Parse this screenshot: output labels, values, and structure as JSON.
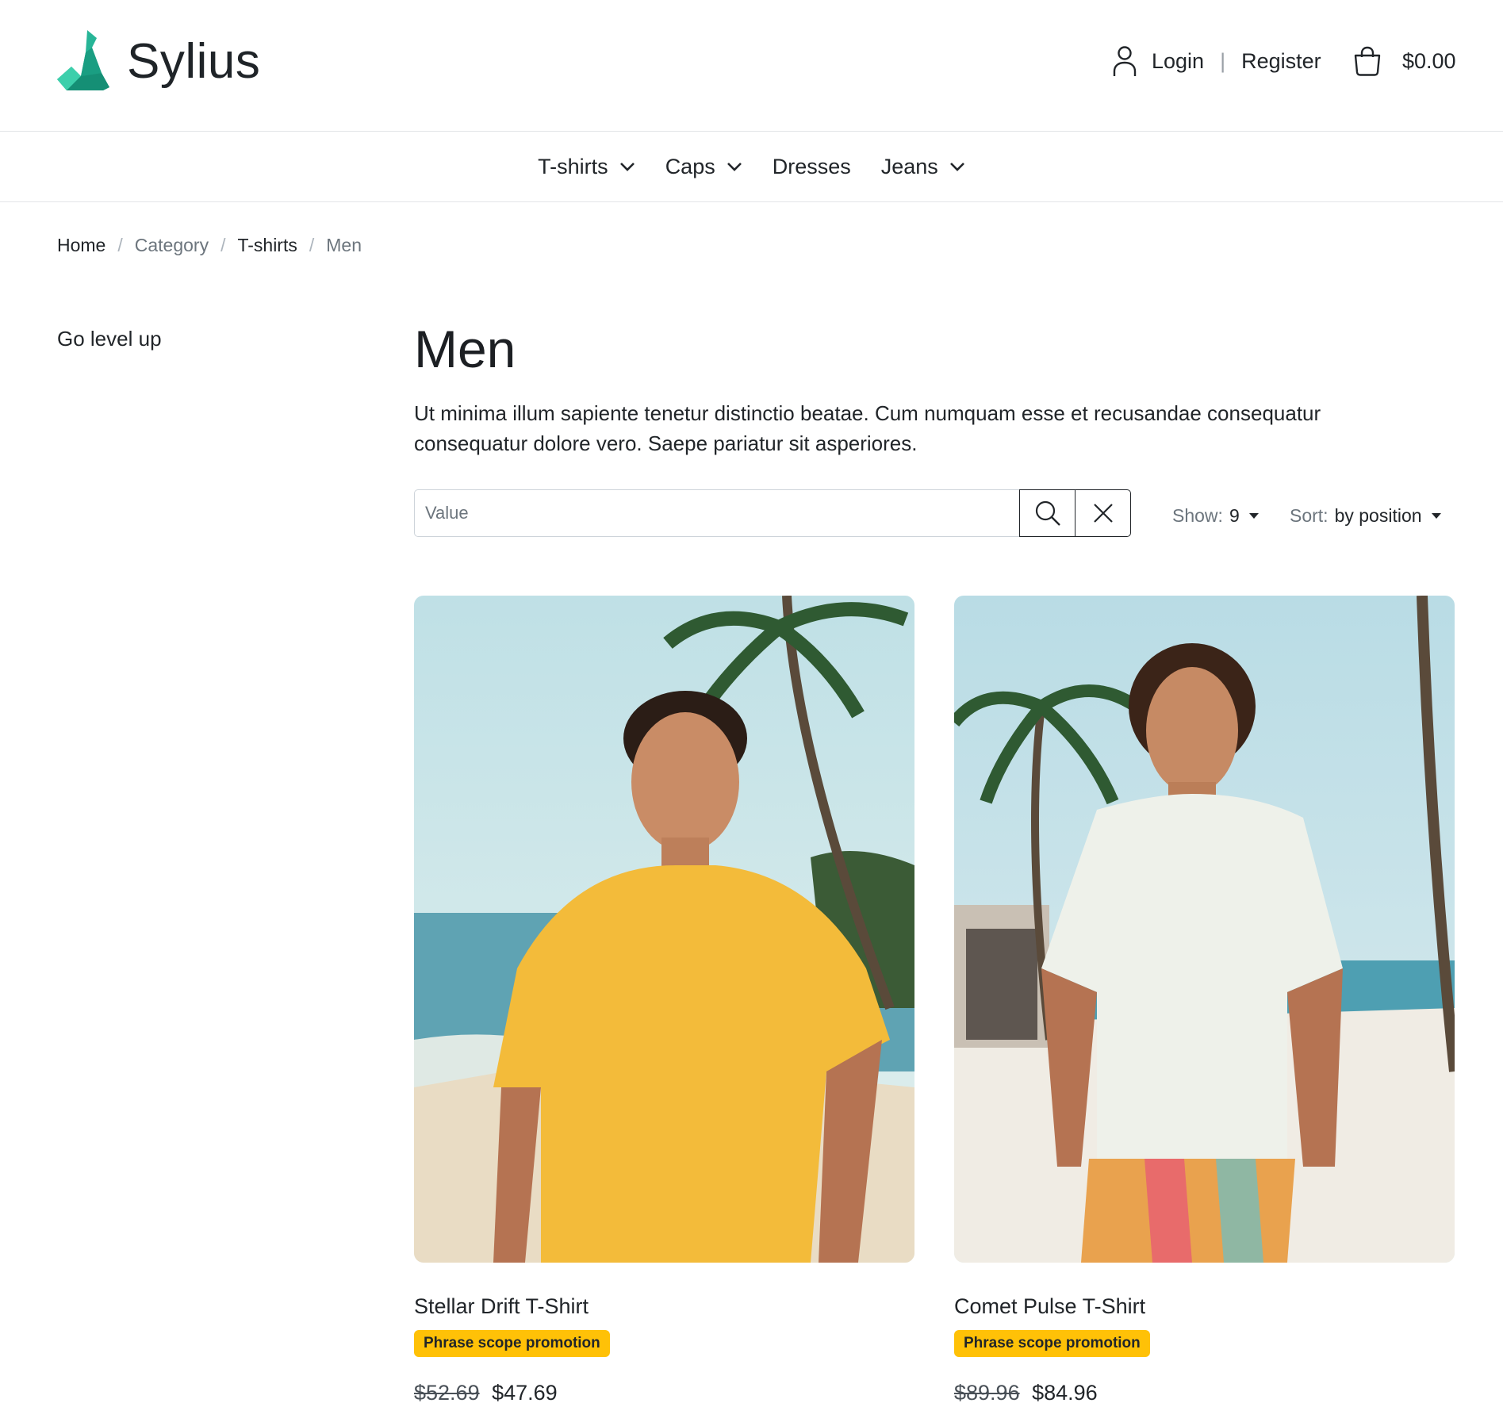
{
  "header": {
    "logo_text": "Sylius",
    "logo_color": "#1abb9c",
    "login_label": "Login",
    "separator": "|",
    "register_label": "Register",
    "cart_total": "$0.00"
  },
  "nav": {
    "items": [
      {
        "label": "T-shirts",
        "has_dropdown": true
      },
      {
        "label": "Caps",
        "has_dropdown": true
      },
      {
        "label": "Dresses",
        "has_dropdown": false
      },
      {
        "label": "Jeans",
        "has_dropdown": true
      }
    ]
  },
  "breadcrumb": {
    "items": [
      "Home",
      "Category",
      "T-shirts",
      "Men"
    ],
    "separator": "/"
  },
  "sidebar": {
    "go_level_up": "Go level up"
  },
  "main": {
    "title": "Men",
    "description": "Ut minima illum sapiente tenetur distinctio beatae. Cum numquam esse et recusandae consequatur consequatur dolore vero. Saepe pariatur sit asperiores.",
    "search": {
      "placeholder": "Value",
      "value": ""
    },
    "show": {
      "label": "Show:",
      "value": "9"
    },
    "sort": {
      "label": "Sort:",
      "value": "by position"
    }
  },
  "products": [
    {
      "name": "Stellar Drift T-Shirt",
      "badge": "Phrase scope promotion",
      "old_price": "$52.69",
      "price": "$47.69",
      "shirt_color": "#f3bb3a"
    },
    {
      "name": "Comet Pulse T-Shirt",
      "badge": "Phrase scope promotion",
      "old_price": "$89.96",
      "price": "$84.96",
      "shirt_color": "#eef1ea"
    }
  ],
  "colors": {
    "badge": "#ffc107",
    "border": "#e3e5e8",
    "text": "#212529"
  }
}
